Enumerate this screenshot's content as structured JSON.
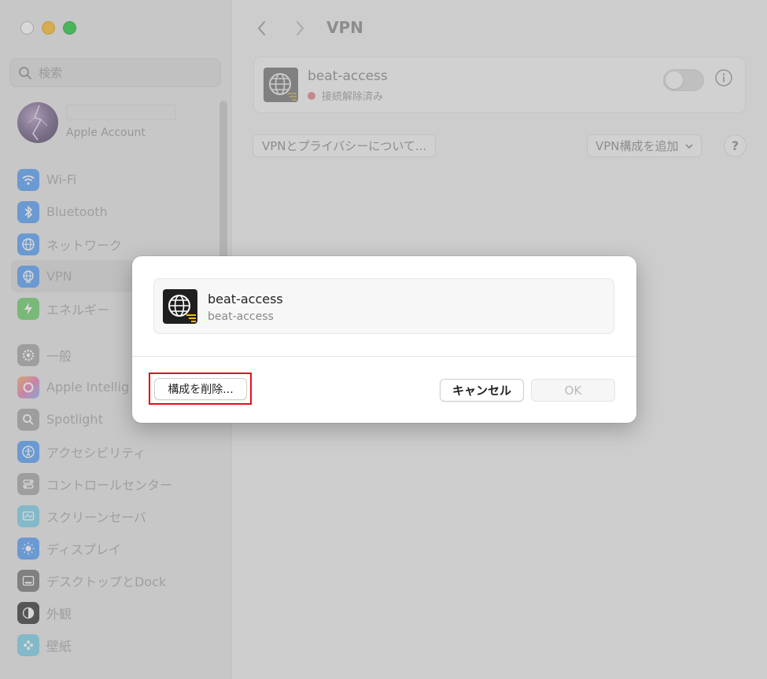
{
  "window": {
    "title": "VPN"
  },
  "sidebar": {
    "search_placeholder": "検索",
    "account_label": "Apple Account",
    "items": [
      {
        "label": "Wi-Fi",
        "icon": "wifi-icon",
        "color": "#5aa0f5"
      },
      {
        "label": "Bluetooth",
        "icon": "bluetooth-icon",
        "color": "#5aa0f5"
      },
      {
        "label": "ネットワーク",
        "icon": "globe-icon",
        "color": "#5aa0f5"
      },
      {
        "label": "VPN",
        "icon": "vpn-globe-icon",
        "color": "#5aa0f5"
      },
      {
        "label": "エネルギー",
        "icon": "bolt-icon",
        "color": "#6fcf6f"
      },
      {
        "label": "一般",
        "icon": "gear-icon",
        "color": "#a8a8a8"
      },
      {
        "label": "Apple Intellig",
        "icon": "apple-intelligence-icon",
        "color": "#f0a0c0"
      },
      {
        "label": "Spotlight",
        "icon": "magnifier-icon",
        "color": "#a8a8a8"
      },
      {
        "label": "アクセシビリティ",
        "icon": "accessibility-icon",
        "color": "#5aa0f5"
      },
      {
        "label": "コントロールセンター",
        "icon": "control-center-icon",
        "color": "#a8a8a8"
      },
      {
        "label": "スクリーンセーバ",
        "icon": "screensaver-icon",
        "color": "#7fd0e8"
      },
      {
        "label": "ディスプレイ",
        "icon": "sun-icon",
        "color": "#5aa0f5"
      },
      {
        "label": "デスクトップとDock",
        "icon": "dock-icon",
        "color": "#7a7a7a"
      },
      {
        "label": "外観",
        "icon": "appearance-icon",
        "color": "#7a7a7a"
      },
      {
        "label": "壁紙",
        "icon": "wallpaper-icon",
        "color": "#7fd0e8"
      }
    ]
  },
  "main": {
    "vpn_name": "beat-access",
    "vpn_status": "接続解除済み",
    "status_color": "#e3858a",
    "privacy_button": "VPNとプライバシーについて...",
    "add_button": "VPN構成を追加",
    "help_label": "?"
  },
  "dialog": {
    "vpn_name": "beat-access",
    "vpn_sub": "beat-access",
    "delete_button": "構成を削除...",
    "cancel_button": "キャンセル",
    "ok_button": "OK",
    "highlight_color": "#e0101b"
  }
}
